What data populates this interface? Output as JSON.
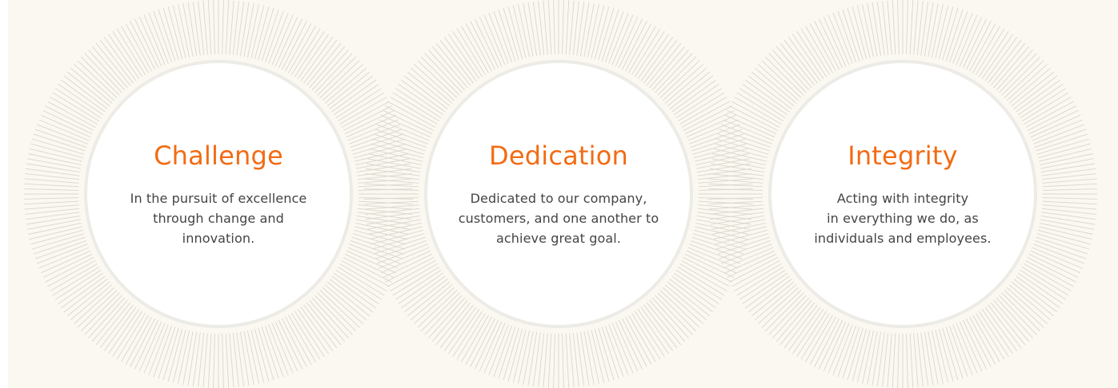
{
  "accent_color": "#f26b14",
  "background_color": "#faf8f1",
  "values": [
    {
      "icon": "sunburst-circle",
      "title": "Challenge",
      "description": "In the pursuit of excellence\nthrough change and\ninnovation."
    },
    {
      "icon": "sunburst-circle",
      "title": "Dedication",
      "description": "Dedicated to our company,\ncustomers, and one another to\nachieve great goal."
    },
    {
      "icon": "sunburst-circle",
      "title": "Integrity",
      "description": "Acting with integrity\nin everything we do, as\nindividuals and employees."
    }
  ]
}
